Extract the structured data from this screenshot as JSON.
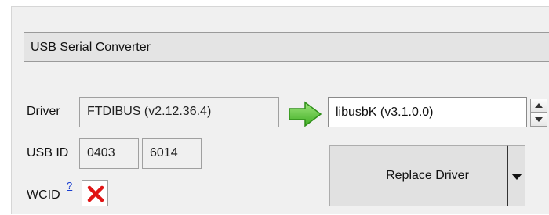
{
  "device": {
    "selected": "USB Serial Converter"
  },
  "driver": {
    "label": "Driver",
    "current": "FTDIBUS (v2.12.36.4)",
    "target": "libusbK (v3.1.0.0)",
    "arrow_icon": "green-right-arrow-icon",
    "spin_icons": [
      "spin-up-icon",
      "spin-down-icon"
    ]
  },
  "usb_id": {
    "label": "USB ID",
    "vendor": "0403",
    "product": "6014"
  },
  "wcid": {
    "label": "WCID",
    "help_link": "?",
    "status_icon": "red-x-icon"
  },
  "actions": {
    "replace_label": "Replace Driver",
    "split_icon": "dropdown-arrow-icon"
  },
  "colors": {
    "arrow_green": "#5cc53a",
    "status_red": "#e01515",
    "link_blue": "#1a3fd0"
  }
}
